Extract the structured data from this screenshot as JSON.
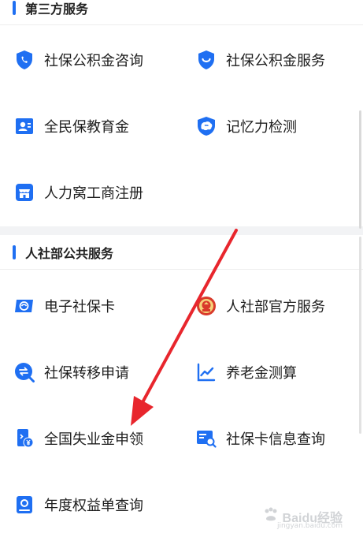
{
  "sections": [
    {
      "title": "第三方服务",
      "items": [
        {
          "label": "社保公积金咨询",
          "icon": "shield-phone-icon"
        },
        {
          "label": "社保公积金服务",
          "icon": "shield-smile-icon"
        },
        {
          "label": "全民保教育金",
          "icon": "id-card-icon"
        },
        {
          "label": "记忆力检测",
          "icon": "brain-shield-icon"
        },
        {
          "label": "人力窝工商注册",
          "icon": "store-icon"
        }
      ]
    },
    {
      "title": "人社部公共服务",
      "items": [
        {
          "label": "电子社保卡",
          "icon": "social-card-icon"
        },
        {
          "label": "人社部官方服务",
          "icon": "emblem-icon"
        },
        {
          "label": "社保转移申请",
          "icon": "transfer-icon"
        },
        {
          "label": "养老金测算",
          "icon": "line-chart-icon"
        },
        {
          "label": "全国失业金申领",
          "icon": "phone-yuan-icon"
        },
        {
          "label": "社保卡信息查询",
          "icon": "card-search-icon"
        },
        {
          "label": "年度权益单查询",
          "icon": "person-search-icon"
        }
      ]
    }
  ],
  "watermark": {
    "text": "Baidu经验",
    "sub": "jingyan.baidu.com"
  },
  "colors": {
    "accent": "#1f6ff2",
    "arrow": "#e8262d",
    "divider": "#f2f3f5"
  }
}
